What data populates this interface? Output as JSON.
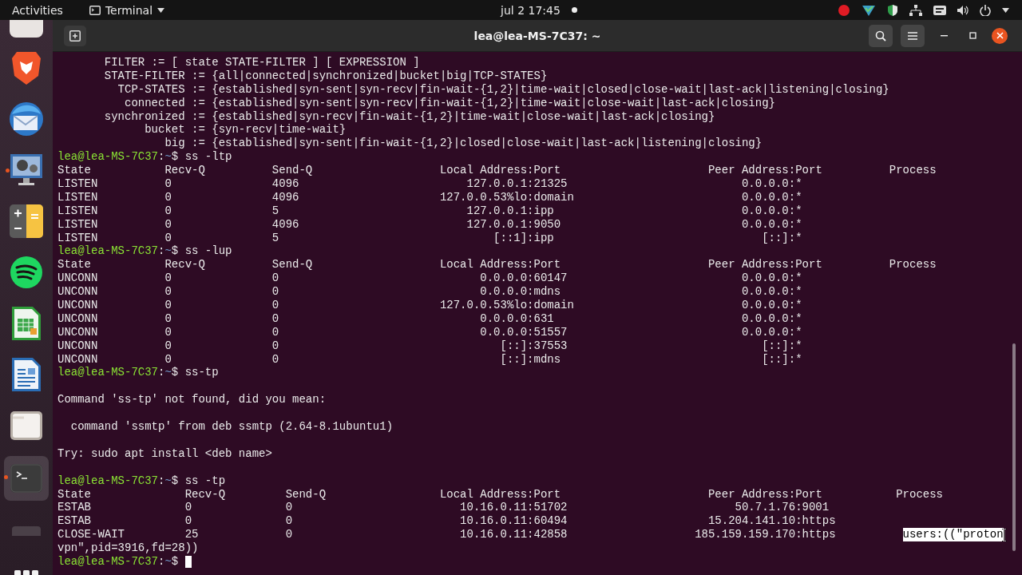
{
  "top_bar": {
    "activities": "Activities",
    "app_menu": "Terminal",
    "clock": "jul 2  17:45",
    "notification": true
  },
  "dock": {
    "items": [
      {
        "kind": "partial",
        "selected": false
      },
      {
        "kind": "lion",
        "running": false,
        "selected": false
      },
      {
        "kind": "mail",
        "running": false,
        "selected": false
      },
      {
        "kind": "video",
        "running": true,
        "selected": false
      },
      {
        "kind": "calculator",
        "running": false,
        "selected": false
      },
      {
        "kind": "music",
        "running": false,
        "selected": false
      },
      {
        "kind": "spreadsheet",
        "running": false,
        "selected": false
      },
      {
        "kind": "writer",
        "running": false,
        "selected": false
      },
      {
        "kind": "files",
        "running": false,
        "selected": false
      },
      {
        "kind": "terminal",
        "running": true,
        "selected": true
      },
      {
        "kind": "cut",
        "selected": false
      },
      {
        "kind": "grid",
        "selected": false
      }
    ]
  },
  "window": {
    "title": "lea@lea-MS-7C37: ~"
  },
  "terminal": {
    "lines": [
      {
        "kind": "output",
        "text": "       FILTER := [ state STATE-FILTER ] [ EXPRESSION ]"
      },
      {
        "kind": "output",
        "text": "       STATE-FILTER := {all|connected|synchronized|bucket|big|TCP-STATES}"
      },
      {
        "kind": "output",
        "text": "         TCP-STATES := {established|syn-sent|syn-recv|fin-wait-{1,2}|time-wait|closed|close-wait|last-ack|listening|closing}"
      },
      {
        "kind": "output",
        "text": "          connected := {established|syn-sent|syn-recv|fin-wait-{1,2}|time-wait|close-wait|last-ack|closing}"
      },
      {
        "kind": "output",
        "text": "       synchronized := {established|syn-recv|fin-wait-{1,2}|time-wait|close-wait|last-ack|closing}"
      },
      {
        "kind": "output",
        "text": "             bucket := {syn-recv|time-wait}"
      },
      {
        "kind": "output",
        "text": "                big := {established|syn-sent|fin-wait-{1,2}|closed|close-wait|last-ack|listening|closing}"
      },
      {
        "kind": "prompt",
        "user_host": "lea@lea-MS-7C37",
        "separator": ":",
        "path": "~",
        "symbol": "$",
        "command": "ss -ltp"
      },
      {
        "kind": "table",
        "columns": [
          "State",
          "Recv-Q",
          "Send-Q",
          "Local Address:Port",
          "Peer Address:Port",
          "Process"
        ],
        "rows": [
          {
            "cells": [
              "LISTEN",
              "0",
              "4096",
              "127.0.0.1:21325",
              "0.0.0.0:*"
            ]
          },
          {
            "cells": [
              "LISTEN",
              "0",
              "4096",
              "127.0.0.53%lo:domain",
              "0.0.0.0:*"
            ]
          },
          {
            "cells": [
              "LISTEN",
              "0",
              "5",
              "127.0.0.1:ipp",
              "0.0.0.0:*"
            ]
          },
          {
            "cells": [
              "LISTEN",
              "0",
              "4096",
              "127.0.0.1:9050",
              "0.0.0.0:*"
            ]
          },
          {
            "cells": [
              "LISTEN",
              "0",
              "5",
              "[::1]:ipp",
              "[::]:*"
            ]
          }
        ]
      },
      {
        "kind": "prompt",
        "user_host": "lea@lea-MS-7C37",
        "separator": ":",
        "path": "~",
        "symbol": "$",
        "command": "ss -lup"
      },
      {
        "kind": "table",
        "columns": [
          "State",
          "Recv-Q",
          "Send-Q",
          "Local Address:Port",
          "Peer Address:Port",
          "Process"
        ],
        "rows": [
          {
            "cells": [
              "UNCONN",
              "0",
              "0",
              "0.0.0.0:60147",
              "0.0.0.0:*"
            ]
          },
          {
            "cells": [
              "UNCONN",
              "0",
              "0",
              "0.0.0.0:mdns",
              "0.0.0.0:*"
            ]
          },
          {
            "cells": [
              "UNCONN",
              "0",
              "0",
              "127.0.0.53%lo:domain",
              "0.0.0.0:*"
            ]
          },
          {
            "cells": [
              "UNCONN",
              "0",
              "0",
              "0.0.0.0:631",
              "0.0.0.0:*"
            ]
          },
          {
            "cells": [
              "UNCONN",
              "0",
              "0",
              "0.0.0.0:51557",
              "0.0.0.0:*"
            ]
          },
          {
            "cells": [
              "UNCONN",
              "0",
              "0",
              "[::]:37553",
              "[::]:*"
            ]
          },
          {
            "cells": [
              "UNCONN",
              "0",
              "0",
              "[::]:mdns",
              "[::]:*"
            ]
          }
        ]
      },
      {
        "kind": "prompt",
        "user_host": "lea@lea-MS-7C37",
        "separator": ":",
        "path": "~",
        "symbol": "$",
        "command": "ss-tp"
      },
      {
        "kind": "blank"
      },
      {
        "kind": "output",
        "text": "Command 'ss-tp' not found, did you mean:"
      },
      {
        "kind": "blank"
      },
      {
        "kind": "output",
        "text": "  command 'ssmtp' from deb ssmtp (2.64-8.1ubuntu1)"
      },
      {
        "kind": "blank"
      },
      {
        "kind": "output",
        "text": "Try: sudo apt install <deb name>"
      },
      {
        "kind": "blank"
      },
      {
        "kind": "prompt",
        "user_host": "lea@lea-MS-7C37",
        "separator": ":",
        "path": "~",
        "symbol": "$",
        "command": "ss -tp"
      },
      {
        "kind": "table",
        "columns": [
          "State",
          "Recv-Q",
          "Send-Q",
          "Local Address:Port",
          "Peer Address:Port",
          "Process"
        ],
        "rows": [
          {
            "cells": [
              "ESTAB",
              "0",
              "0",
              "10.16.0.11:51702",
              "50.7.1.76:9001"
            ]
          },
          {
            "cells": [
              "ESTAB",
              "0",
              "0",
              "10.16.0.11:60494",
              "15.204.141.10:https"
            ]
          },
          {
            "cells": [
              "CLOSE-WAIT",
              "25",
              "0",
              "10.16.0.11:42858",
              "185.159.159.170:https"
            ],
            "process": {
              "text": "users:((\"proton",
              "selected": true
            }
          }
        ]
      },
      {
        "kind": "output",
        "text": "vpn\",pid=3916,fd=28))"
      },
      {
        "kind": "prompt",
        "user_host": "lea@lea-MS-7C37",
        "separator": ":",
        "path": "~",
        "symbol": "$",
        "cursor": true
      }
    ]
  }
}
